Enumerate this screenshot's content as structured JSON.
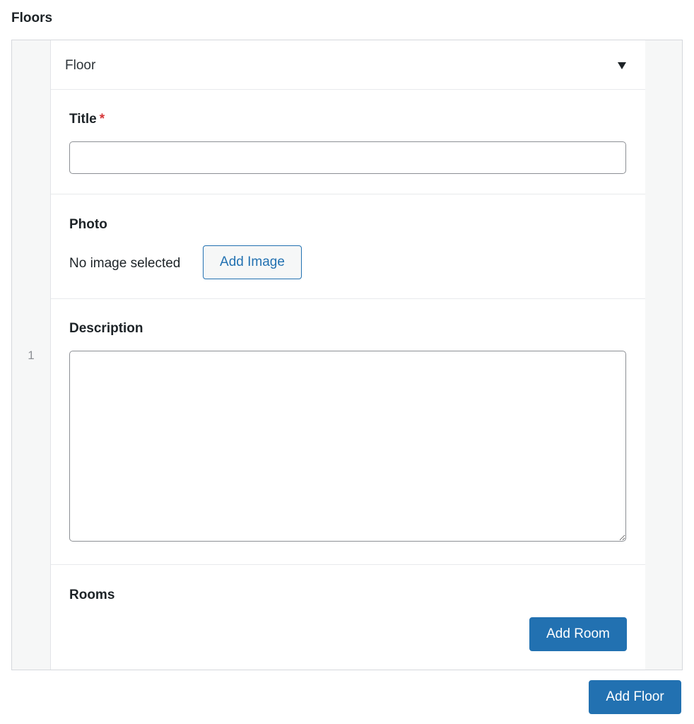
{
  "section": {
    "title": "Floors"
  },
  "row": {
    "index": "1",
    "layout_title": "Floor",
    "fields": {
      "title": {
        "label": "Title",
        "required_mark": "*",
        "value": "",
        "placeholder": ""
      },
      "photo": {
        "label": "Photo",
        "status": "No image selected",
        "add_image_label": "Add Image"
      },
      "description": {
        "label": "Description",
        "value": "",
        "placeholder": ""
      },
      "rooms": {
        "label": "Rooms",
        "add_room_label": "Add Room"
      }
    }
  },
  "actions": {
    "add_floor_label": "Add Floor"
  },
  "icons": {
    "collapse": "caret-down-icon",
    "resize": "resize-handle-icon"
  },
  "colors": {
    "primary": "#2271b1",
    "required": "#d63638",
    "border": "#8c8f94"
  }
}
